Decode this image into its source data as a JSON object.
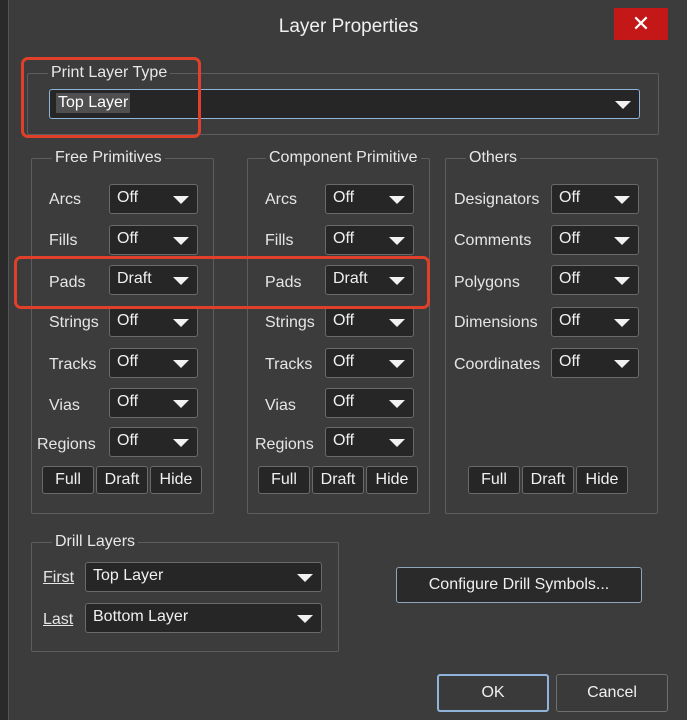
{
  "title": "Layer Properties",
  "close_symbol": "✕",
  "print_layer_type": {
    "label": "Print Layer Type",
    "value": "Top Layer"
  },
  "free_primitives": {
    "title": "Free Primitives",
    "rows": [
      {
        "label": "Arcs",
        "value": "Off"
      },
      {
        "label": "Fills",
        "value": "Off"
      },
      {
        "label": "Pads",
        "value": "Draft"
      },
      {
        "label": "Strings",
        "value": "Off"
      },
      {
        "label": "Tracks",
        "value": "Off"
      },
      {
        "label": "Vias",
        "value": "Off"
      },
      {
        "label": "Regions",
        "value": "Off"
      }
    ],
    "buttons": [
      "Full",
      "Draft",
      "Hide"
    ]
  },
  "component_primitive": {
    "title": "Component Primitive",
    "rows": [
      {
        "label": "Arcs",
        "value": "Off"
      },
      {
        "label": "Fills",
        "value": "Off"
      },
      {
        "label": "Pads",
        "value": "Draft"
      },
      {
        "label": "Strings",
        "value": "Off"
      },
      {
        "label": "Tracks",
        "value": "Off"
      },
      {
        "label": "Vias",
        "value": "Off"
      },
      {
        "label": "Regions",
        "value": "Off"
      }
    ],
    "buttons": [
      "Full",
      "Draft",
      "Hide"
    ]
  },
  "others": {
    "title": "Others",
    "rows": [
      {
        "label": "Designators",
        "value": "Off"
      },
      {
        "label": "Comments",
        "value": "Off"
      },
      {
        "label": "Polygons",
        "value": "Off"
      },
      {
        "label": "Dimensions",
        "value": "Off"
      },
      {
        "label": "Coordinates",
        "value": "Off"
      }
    ],
    "buttons": [
      "Full",
      "Draft",
      "Hide"
    ]
  },
  "drill_layers": {
    "title": "Drill Layers",
    "first_label": "First",
    "first_value": "Top Layer",
    "last_label": "Last",
    "last_value": "Bottom Layer"
  },
  "configure_drill_symbols_label": "Configure Drill Symbols...",
  "ok_label": "OK",
  "cancel_label": "Cancel",
  "colors": {
    "highlight_red": "#e0402a",
    "close_red": "#c41818",
    "dialog_bg": "#3c3c3c"
  }
}
